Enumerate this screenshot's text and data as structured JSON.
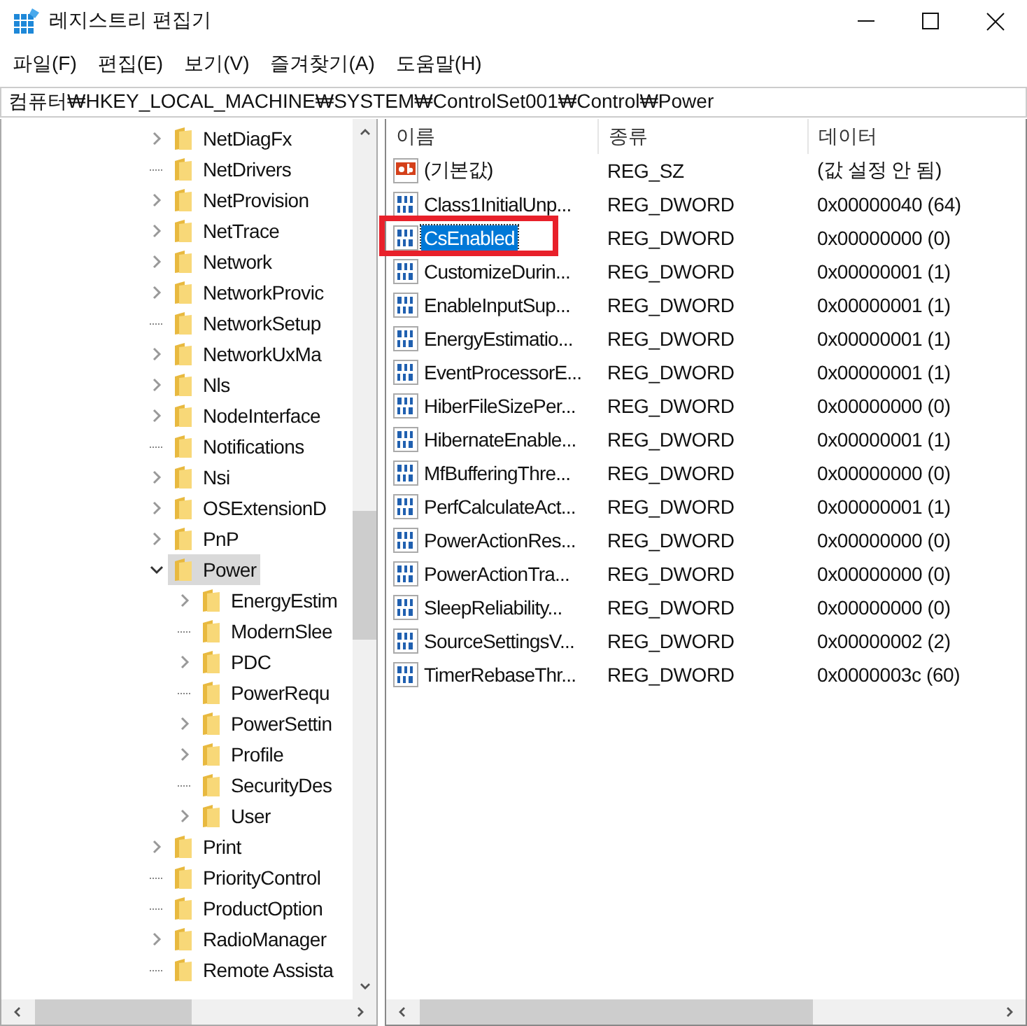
{
  "window": {
    "title": "레지스트리 편집기"
  },
  "menu": [
    {
      "label": "파일(F)"
    },
    {
      "label": "편집(E)"
    },
    {
      "label": "보기(V)"
    },
    {
      "label": "즐겨찾기(A)"
    },
    {
      "label": "도움말(H)"
    }
  ],
  "address": {
    "value": "컴퓨터₩HKEY_LOCAL_MACHINE₩SYSTEM₩ControlSet001₩Control₩Power"
  },
  "tree": [
    {
      "label": "NetDiagFx",
      "has_children": true,
      "expanded": false,
      "selected": false
    },
    {
      "label": "NetDrivers",
      "has_children": false,
      "expanded": false,
      "selected": false
    },
    {
      "label": "NetProvision",
      "has_children": true,
      "expanded": false,
      "selected": false
    },
    {
      "label": "NetTrace",
      "has_children": true,
      "expanded": false,
      "selected": false
    },
    {
      "label": "Network",
      "has_children": true,
      "expanded": false,
      "selected": false
    },
    {
      "label": "NetworkProvic",
      "has_children": true,
      "expanded": false,
      "selected": false
    },
    {
      "label": "NetworkSetup",
      "has_children": false,
      "expanded": false,
      "selected": false
    },
    {
      "label": "NetworkUxMa",
      "has_children": true,
      "expanded": false,
      "selected": false
    },
    {
      "label": "Nls",
      "has_children": true,
      "expanded": false,
      "selected": false
    },
    {
      "label": "NodeInterface",
      "has_children": true,
      "expanded": false,
      "selected": false
    },
    {
      "label": "Notifications",
      "has_children": false,
      "expanded": false,
      "selected": false
    },
    {
      "label": "Nsi",
      "has_children": true,
      "expanded": false,
      "selected": false
    },
    {
      "label": "OSExtensionD",
      "has_children": true,
      "expanded": false,
      "selected": false
    },
    {
      "label": "PnP",
      "has_children": true,
      "expanded": false,
      "selected": false
    },
    {
      "label": "Power",
      "has_children": true,
      "expanded": true,
      "selected": true,
      "children": [
        {
          "label": "EnergyEstim",
          "has_children": true,
          "expanded": false,
          "selected": false
        },
        {
          "label": "ModernSlee",
          "has_children": false,
          "expanded": false,
          "selected": false
        },
        {
          "label": "PDC",
          "has_children": true,
          "expanded": false,
          "selected": false
        },
        {
          "label": "PowerRequ",
          "has_children": false,
          "expanded": false,
          "selected": false
        },
        {
          "label": "PowerSettin",
          "has_children": true,
          "expanded": false,
          "selected": false
        },
        {
          "label": "Profile",
          "has_children": true,
          "expanded": false,
          "selected": false
        },
        {
          "label": "SecurityDes",
          "has_children": false,
          "expanded": false,
          "selected": false
        },
        {
          "label": "User",
          "has_children": true,
          "expanded": false,
          "selected": false
        }
      ]
    },
    {
      "label": "Print",
      "has_children": true,
      "expanded": false,
      "selected": false
    },
    {
      "label": "PriorityControl",
      "has_children": false,
      "expanded": false,
      "selected": false
    },
    {
      "label": "ProductOption",
      "has_children": false,
      "expanded": false,
      "selected": false
    },
    {
      "label": "RadioManager",
      "has_children": true,
      "expanded": false,
      "selected": false
    },
    {
      "label": "Remote Assista",
      "has_children": false,
      "expanded": false,
      "selected": false
    }
  ],
  "values": {
    "columns": [
      "이름",
      "종류",
      "데이터"
    ],
    "rows": [
      {
        "kind": "string",
        "name": "(기본값)",
        "type": "REG_SZ",
        "data": "(값 설정 안 됨)",
        "selected": false,
        "annotated": false
      },
      {
        "kind": "binary",
        "name": "Class1InitialUnp...",
        "type": "REG_DWORD",
        "data": "0x00000040 (64)",
        "selected": false,
        "annotated": false
      },
      {
        "kind": "binary",
        "name": "CsEnabled",
        "type": "REG_DWORD",
        "data": "0x00000000 (0)",
        "selected": true,
        "annotated": true
      },
      {
        "kind": "binary",
        "name": "CustomizeDurin...",
        "type": "REG_DWORD",
        "data": "0x00000001 (1)",
        "selected": false,
        "annotated": false
      },
      {
        "kind": "binary",
        "name": "EnableInputSup...",
        "type": "REG_DWORD",
        "data": "0x00000001 (1)",
        "selected": false,
        "annotated": false
      },
      {
        "kind": "binary",
        "name": "EnergyEstimatio...",
        "type": "REG_DWORD",
        "data": "0x00000001 (1)",
        "selected": false,
        "annotated": false
      },
      {
        "kind": "binary",
        "name": "EventProcessorE...",
        "type": "REG_DWORD",
        "data": "0x00000001 (1)",
        "selected": false,
        "annotated": false
      },
      {
        "kind": "binary",
        "name": "HiberFileSizePer...",
        "type": "REG_DWORD",
        "data": "0x00000000 (0)",
        "selected": false,
        "annotated": false
      },
      {
        "kind": "binary",
        "name": "HibernateEnable...",
        "type": "REG_DWORD",
        "data": "0x00000001 (1)",
        "selected": false,
        "annotated": false
      },
      {
        "kind": "binary",
        "name": "MfBufferingThre...",
        "type": "REG_DWORD",
        "data": "0x00000000 (0)",
        "selected": false,
        "annotated": false
      },
      {
        "kind": "binary",
        "name": "PerfCalculateAct...",
        "type": "REG_DWORD",
        "data": "0x00000001 (1)",
        "selected": false,
        "annotated": false
      },
      {
        "kind": "binary",
        "name": "PowerActionRes...",
        "type": "REG_DWORD",
        "data": "0x00000000 (0)",
        "selected": false,
        "annotated": false
      },
      {
        "kind": "binary",
        "name": "PowerActionTra...",
        "type": "REG_DWORD",
        "data": "0x00000000 (0)",
        "selected": false,
        "annotated": false
      },
      {
        "kind": "binary",
        "name": "SleepReliability...",
        "type": "REG_DWORD",
        "data": "0x00000000 (0)",
        "selected": false,
        "annotated": false
      },
      {
        "kind": "binary",
        "name": "SourceSettingsV...",
        "type": "REG_DWORD",
        "data": "0x00000002 (2)",
        "selected": false,
        "annotated": false
      },
      {
        "kind": "binary",
        "name": "TimerRebaseThr...",
        "type": "REG_DWORD",
        "data": "0x0000003c (60)",
        "selected": false,
        "annotated": false
      }
    ]
  }
}
